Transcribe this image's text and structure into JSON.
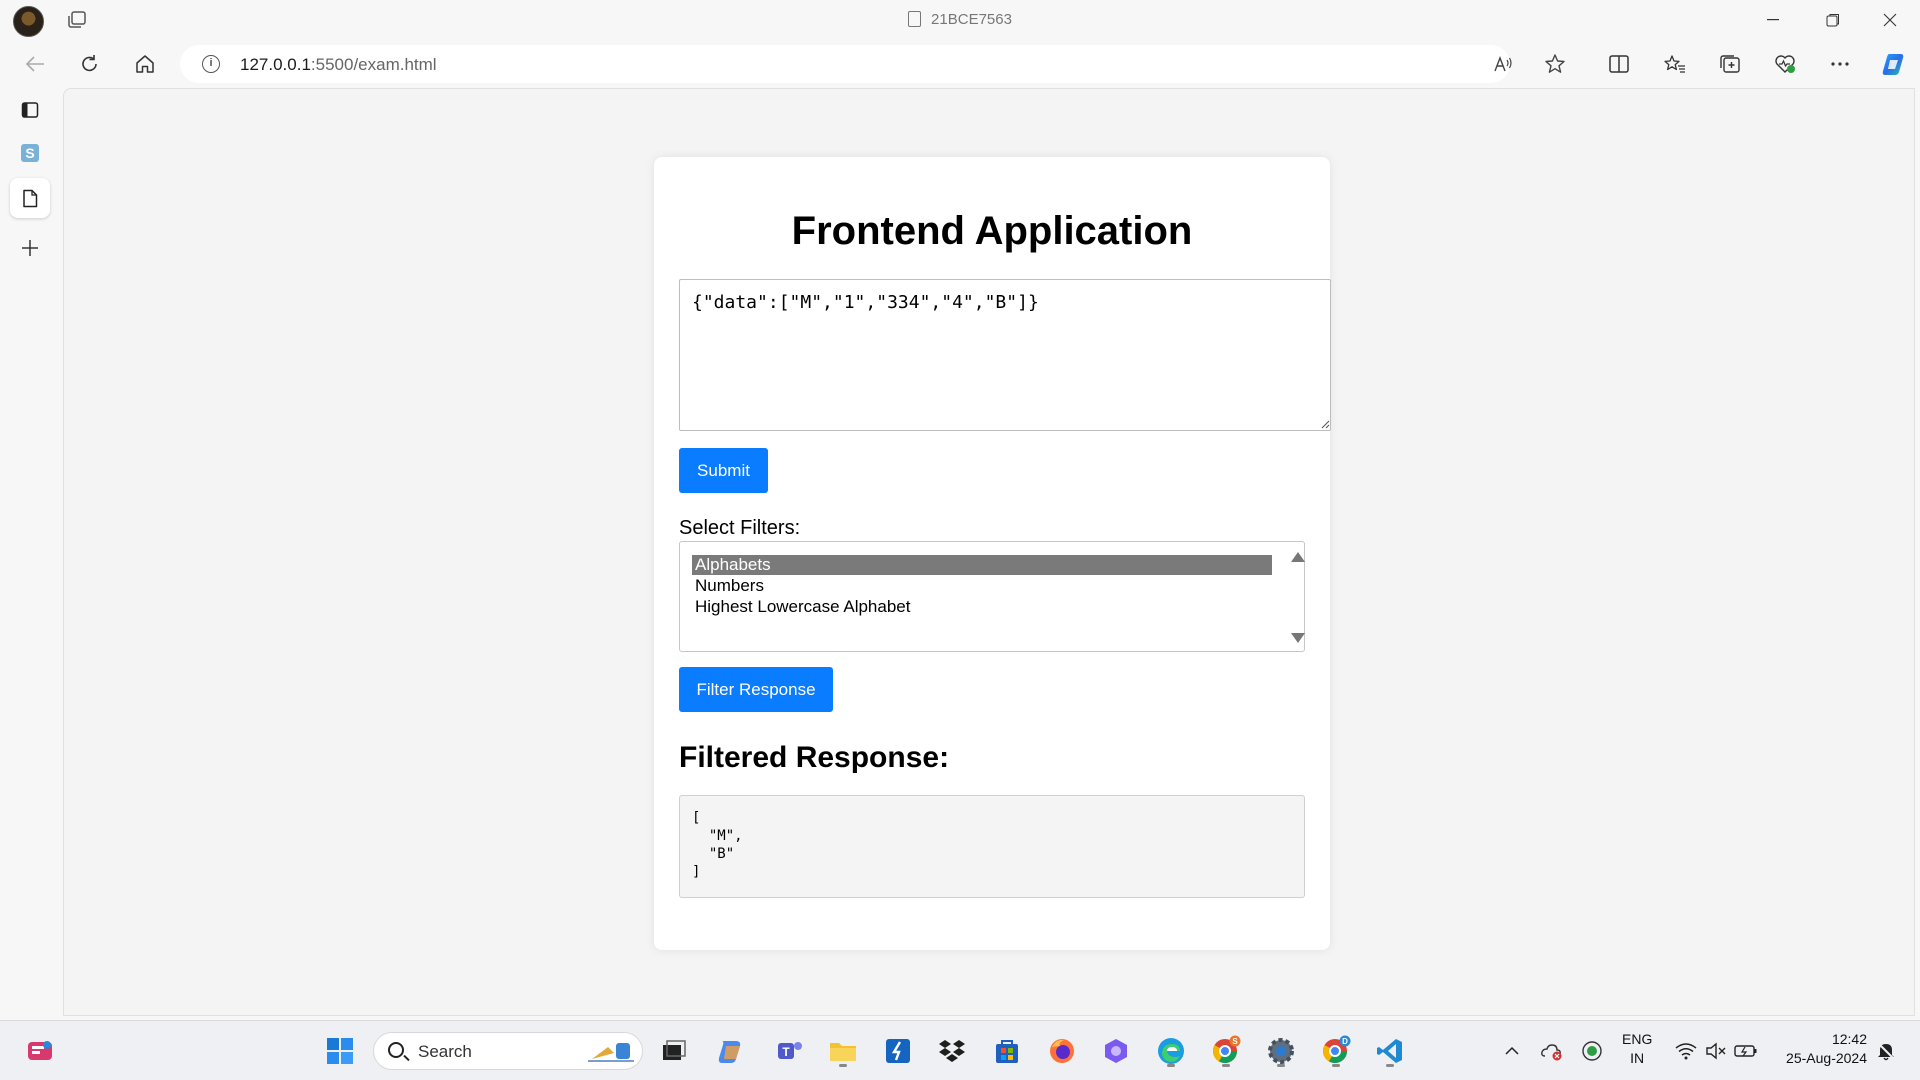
{
  "browser": {
    "window_title": "21BCE7563",
    "url_host": "127.0.0.1",
    "url_path": ":5500/exam.html"
  },
  "page": {
    "title": "Frontend Application",
    "json_input_value": "{\"data\":[\"M\",\"1\",\"334\",\"4\",\"B\"]}",
    "submit_label": "Submit",
    "filters_label": "Select Filters:",
    "filter_options": [
      {
        "label": "Alphabets",
        "selected": true
      },
      {
        "label": "Numbers",
        "selected": false
      },
      {
        "label": "Highest Lowercase Alphabet",
        "selected": false
      }
    ],
    "filter_button_label": "Filter Response",
    "result_heading": "Filtered Response:",
    "result_text": "[\n  \"M\",\n  \"B\"\n]"
  },
  "taskbar": {
    "search_label": "Search",
    "language_line1": "ENG",
    "language_line2": "IN",
    "time": "12:42",
    "date": "25-Aug-2024"
  },
  "colors": {
    "primary_button": "#0a7cff",
    "selected_option": "#7a7a7a"
  },
  "icons": [
    "profile-avatar",
    "tabs-icon",
    "back-icon",
    "refresh-icon",
    "home-icon",
    "info-icon",
    "read-aloud-icon",
    "favorite-star-icon",
    "split-screen-icon",
    "favorites-icon",
    "collections-icon",
    "browser-essentials-icon",
    "more-icon",
    "copilot-icon"
  ]
}
